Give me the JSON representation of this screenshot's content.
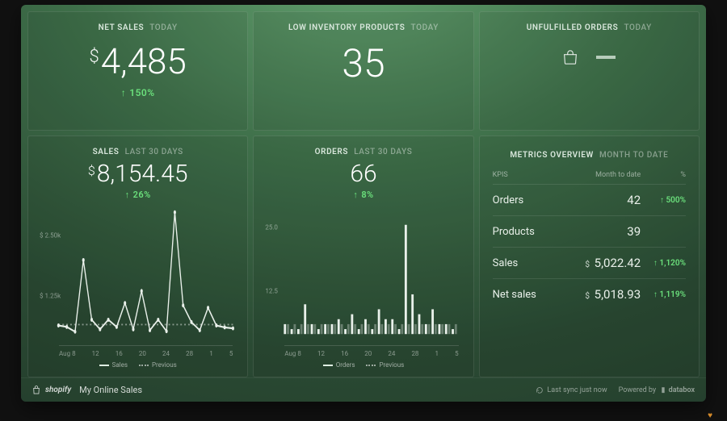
{
  "tiles": {
    "net_sales": {
      "title": "NET SALES",
      "period": "TODAY",
      "currency": "$",
      "value": "4,485",
      "delta": "150%"
    },
    "low_inv": {
      "title": "LOW INVENTORY PRODUCTS",
      "period": "TODAY",
      "value": "35"
    },
    "unfulfilled": {
      "title": "UNFULFILLED ORDERS",
      "period": "TODAY"
    },
    "sales30": {
      "title": "SALES",
      "period": "LAST 30 DAYS",
      "currency": "$",
      "value": "8,154.45",
      "delta": "26%",
      "legend_a": "Sales",
      "legend_b": "Previous"
    },
    "orders30": {
      "title": "ORDERS",
      "period": "LAST 30 DAYS",
      "value": "66",
      "delta": "8%",
      "legend_a": "Orders",
      "legend_b": "Previous"
    },
    "metrics": {
      "title": "METRICS OVERVIEW",
      "period": "MONTH TO DATE",
      "col_a": "KPIS",
      "col_b": "Month to date",
      "col_c": "%",
      "rows": [
        {
          "label": "Orders",
          "value": "42",
          "currency": "",
          "pct": "500%"
        },
        {
          "label": "Products",
          "value": "39",
          "currency": "",
          "pct": ""
        },
        {
          "label": "Sales",
          "value": "5,022.42",
          "currency": "$",
          "pct": "1,120%"
        },
        {
          "label": "Net sales",
          "value": "5,018.93",
          "currency": "$",
          "pct": "1,119%"
        }
      ]
    }
  },
  "footer": {
    "brand": "shopify",
    "page": "My Online Sales",
    "sync": "Last sync just now",
    "powered": "Powered by",
    "provider": "databox"
  },
  "chart_data": [
    {
      "type": "line",
      "title": "Sales last 30 days",
      "ylabel": "$",
      "ylim": [
        0,
        2600
      ],
      "y_ticks": [
        "$ 2.50k",
        "$ 1.25k"
      ],
      "categories": [
        "Aug 8",
        "12",
        "16",
        "20",
        "24",
        "28",
        "1",
        "5"
      ],
      "series": [
        {
          "name": "Sales",
          "values": [
            180,
            150,
            50,
            1550,
            300,
            100,
            300,
            150,
            650,
            100,
            900,
            80,
            300,
            60,
            2550,
            600,
            250,
            80,
            550,
            180,
            140,
            120
          ]
        },
        {
          "name": "Previous",
          "values": [
            200,
            200,
            200,
            200,
            200,
            200,
            200,
            200,
            200,
            200,
            200,
            200,
            200,
            200,
            200,
            200,
            200,
            200,
            200,
            200,
            200,
            200
          ]
        }
      ]
    },
    {
      "type": "bar",
      "title": "Orders last 30 days",
      "ylabel": "",
      "ylim": [
        0,
        25
      ],
      "y_ticks": [
        "25.0",
        "12.5"
      ],
      "categories": [
        "Aug 8",
        "12",
        "16",
        "20",
        "24",
        "28",
        "1",
        "5"
      ],
      "series": [
        {
          "name": "Orders",
          "values": [
            2,
            1,
            1,
            6,
            2,
            1,
            2,
            2,
            3,
            1,
            4,
            1,
            3,
            1,
            5,
            3,
            3,
            1,
            22,
            8,
            4,
            2,
            5,
            2,
            2,
            1
          ]
        },
        {
          "name": "Previous",
          "values": [
            2,
            2,
            2,
            2,
            2,
            2,
            2,
            2,
            2,
            2,
            2,
            2,
            2,
            2,
            2,
            2,
            2,
            2,
            2,
            2,
            2,
            2,
            2,
            2,
            2,
            2
          ]
        }
      ]
    }
  ]
}
